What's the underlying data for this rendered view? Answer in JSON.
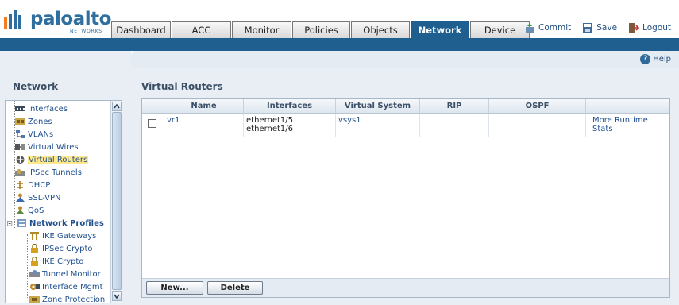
{
  "logo": {
    "text": "paloalto",
    "sub": "NETWORKS"
  },
  "tabs": [
    "Dashboard",
    "ACC",
    "Monitor",
    "Policies",
    "Objects",
    "Network",
    "Device"
  ],
  "active_tab": "Network",
  "toplinks": {
    "commit": "Commit",
    "save": "Save",
    "logout": "Logout"
  },
  "help": "Help",
  "left": {
    "title": "Network",
    "items": [
      {
        "label": "Interfaces",
        "icon": "interfaces-icon"
      },
      {
        "label": "Zones",
        "icon": "zones-icon"
      },
      {
        "label": "VLANs",
        "icon": "vlans-icon"
      },
      {
        "label": "Virtual Wires",
        "icon": "virtual-wires-icon"
      },
      {
        "label": "Virtual Routers",
        "icon": "virtual-routers-icon",
        "selected": true
      },
      {
        "label": "IPSec Tunnels",
        "icon": "ipsec-tunnels-icon"
      },
      {
        "label": "DHCP",
        "icon": "dhcp-icon"
      },
      {
        "label": "SSL-VPN",
        "icon": "ssl-vpn-icon"
      },
      {
        "label": "QoS",
        "icon": "qos-icon"
      },
      {
        "label": "Network Profiles",
        "icon": "network-profiles-icon",
        "bold": true
      },
      {
        "label": "IKE Gateways",
        "icon": "ike-gateways-icon"
      },
      {
        "label": "IPSec Crypto",
        "icon": "ipsec-crypto-icon"
      },
      {
        "label": "IKE Crypto",
        "icon": "ike-crypto-icon"
      },
      {
        "label": "Tunnel Monitor",
        "icon": "tunnel-monitor-icon"
      },
      {
        "label": "Interface Mgmt",
        "icon": "interface-mgmt-icon"
      },
      {
        "label": "Zone Protection",
        "icon": "zone-protection-icon"
      }
    ]
  },
  "main": {
    "title": "Virtual Routers",
    "columns": [
      "Name",
      "Interfaces",
      "Virtual System",
      "RIP",
      "OSPF"
    ],
    "rows": [
      {
        "name": "vr1",
        "interfaces": [
          "ethernet1/5",
          "ethernet1/6"
        ],
        "virtual_system": "vsys1",
        "rip": "",
        "ospf": "",
        "action": "More Runtime Stats"
      }
    ],
    "buttons": {
      "new": "New...",
      "delete": "Delete"
    }
  }
}
